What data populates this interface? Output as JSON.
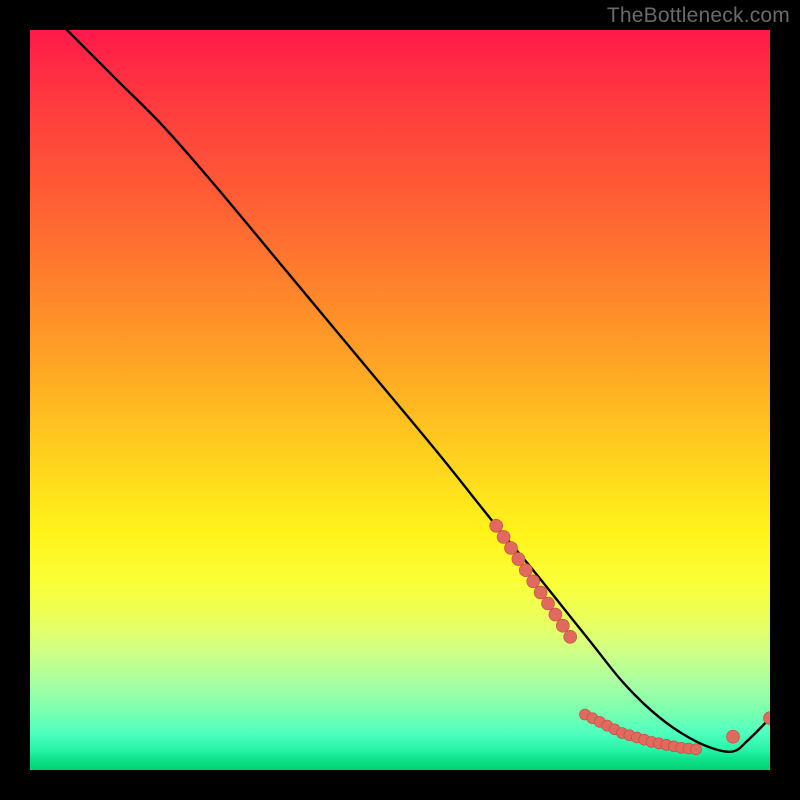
{
  "watermark": "TheBottleneck.com",
  "colors": {
    "background": "#000000",
    "watermark_text": "#6a6a6a",
    "curve_stroke": "#000000",
    "marker_fill": "#e16a5f",
    "marker_stroke": "#c24a41"
  },
  "chart_data": {
    "type": "line",
    "title": "",
    "xlabel": "",
    "ylabel": "",
    "xlim": [
      0,
      100
    ],
    "ylim": [
      0,
      100
    ],
    "grid": false,
    "series": [
      {
        "name": "bottleneck-curve",
        "x": [
          5,
          8,
          12,
          18,
          25,
          35,
          45,
          55,
          63,
          68,
          72,
          76,
          80,
          84,
          88,
          92,
          95,
          97,
          100
        ],
        "y": [
          100,
          97,
          93,
          87,
          79,
          67,
          55,
          43,
          33,
          27,
          22,
          17,
          12,
          8,
          5,
          3,
          2.5,
          4,
          7
        ]
      }
    ],
    "markers_left_cluster": {
      "comment": "dense salmon points along steep segment (~x 63–73)",
      "x": [
        63,
        64,
        65,
        66,
        67,
        68,
        69,
        70,
        71,
        72,
        73
      ],
      "y": [
        33,
        31.5,
        30,
        28.5,
        27,
        25.5,
        24,
        22.5,
        21,
        19.5,
        18
      ]
    },
    "markers_bottom_cluster": {
      "comment": "dense salmon points along trough (~x 75–90)",
      "x": [
        75,
        76,
        77,
        78,
        79,
        80,
        81,
        82,
        83,
        84,
        85,
        86,
        87,
        88,
        89,
        90
      ],
      "y": [
        7.5,
        7,
        6.5,
        6,
        5.5,
        5,
        4.7,
        4.4,
        4.1,
        3.8,
        3.6,
        3.4,
        3.2,
        3.0,
        2.9,
        2.8
      ]
    },
    "markers_right_pair": {
      "comment": "two salmon points on the rising tail (~x 95 & 100)",
      "x": [
        95,
        100
      ],
      "y": [
        4.5,
        7
      ]
    }
  }
}
